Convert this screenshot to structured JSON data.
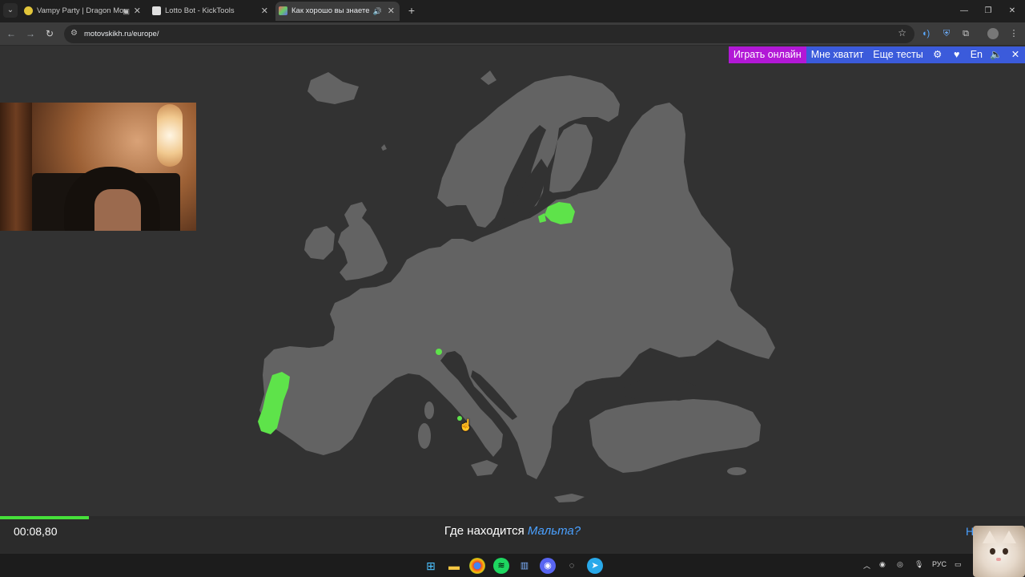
{
  "browser": {
    "tabs": [
      {
        "title": "Vampy Party | Dragon Mone",
        "active": false
      },
      {
        "title": "Lotto Bot - KickTools",
        "active": false
      },
      {
        "title": "Как хорошо вы знаете Евр",
        "active": true
      }
    ],
    "url": "motovskikh.ru/europe/"
  },
  "menu": {
    "play_online": "Играть онлайн",
    "enough": "Мне хватит",
    "more_tests": "Еще тесты",
    "lang": "En"
  },
  "game": {
    "timer": "00:08,80",
    "question_prefix": "Где находится",
    "question_target": "Мальта?",
    "help_partial": "Н",
    "progress": 0.087,
    "found_countries": [
      "Portugal",
      "Estonia",
      "Liechtenstein",
      "Vatican"
    ]
  },
  "taskbar": {
    "lang": "РУС"
  },
  "colors": {
    "map_land": "#636363",
    "map_found": "#5ee34a",
    "sea": "#323232",
    "accent_play": "#b218d6",
    "accent_menu": "#3b5bdb"
  }
}
